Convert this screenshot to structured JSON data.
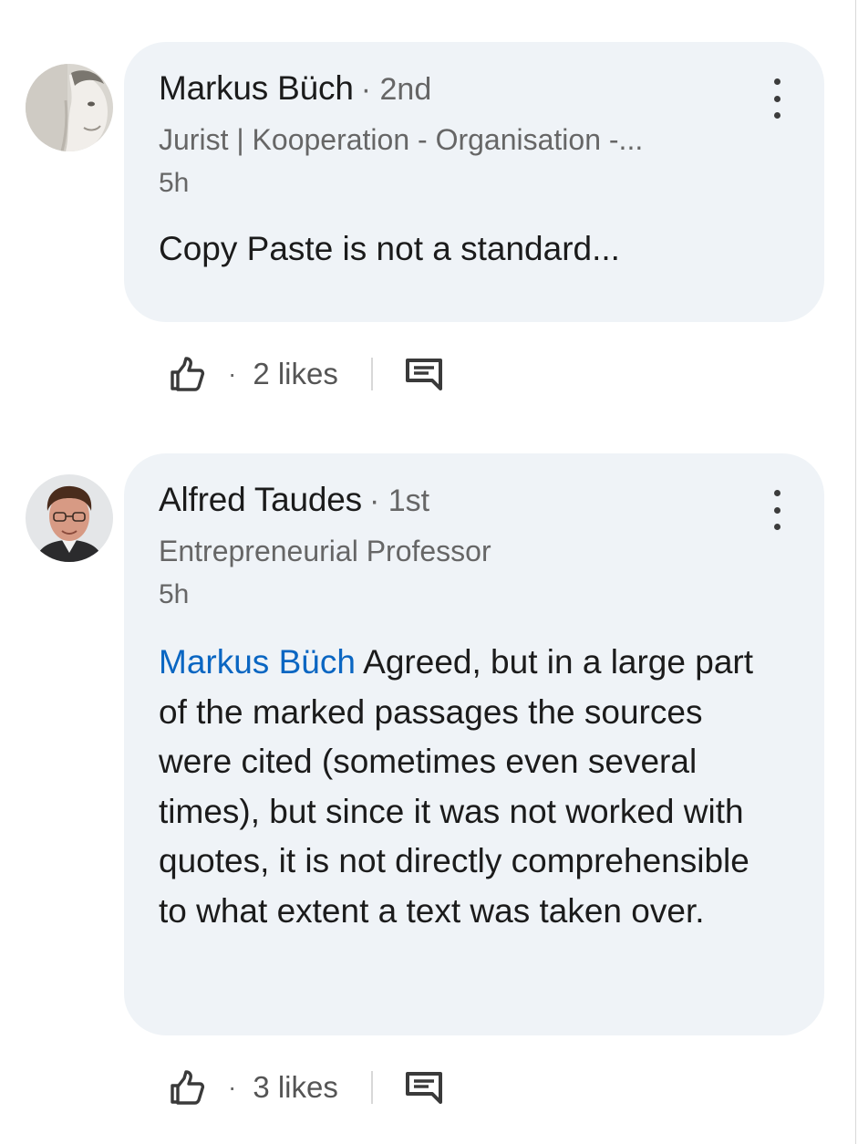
{
  "comments": [
    {
      "author": "Markus Büch",
      "degree": "2nd",
      "headline": "Jurist | Kooperation - Organisation -...",
      "time": "5h",
      "mention": "",
      "text": "Copy Paste is not a standard...",
      "likes": "2 likes"
    },
    {
      "author": "Alfred Taudes",
      "degree": "1st",
      "headline": "Entrepreneurial Professor",
      "time": "5h",
      "mention": "Markus Büch",
      "text": "Agreed, but in a large part of the marked passages the sources were cited (sometimes even several times), but since it was not worked with quotes, it is not directly comprehensible to what extent a text was taken over.",
      "likes": "3 likes"
    }
  ],
  "separator": "·",
  "icons": {
    "like": "thumbs-up-icon",
    "reply": "comment-icon",
    "menu": "more-vertical-icon"
  },
  "colors": {
    "bubble": "#eff3f7",
    "mention": "#0a66c2",
    "secondary_text": "#666666"
  }
}
